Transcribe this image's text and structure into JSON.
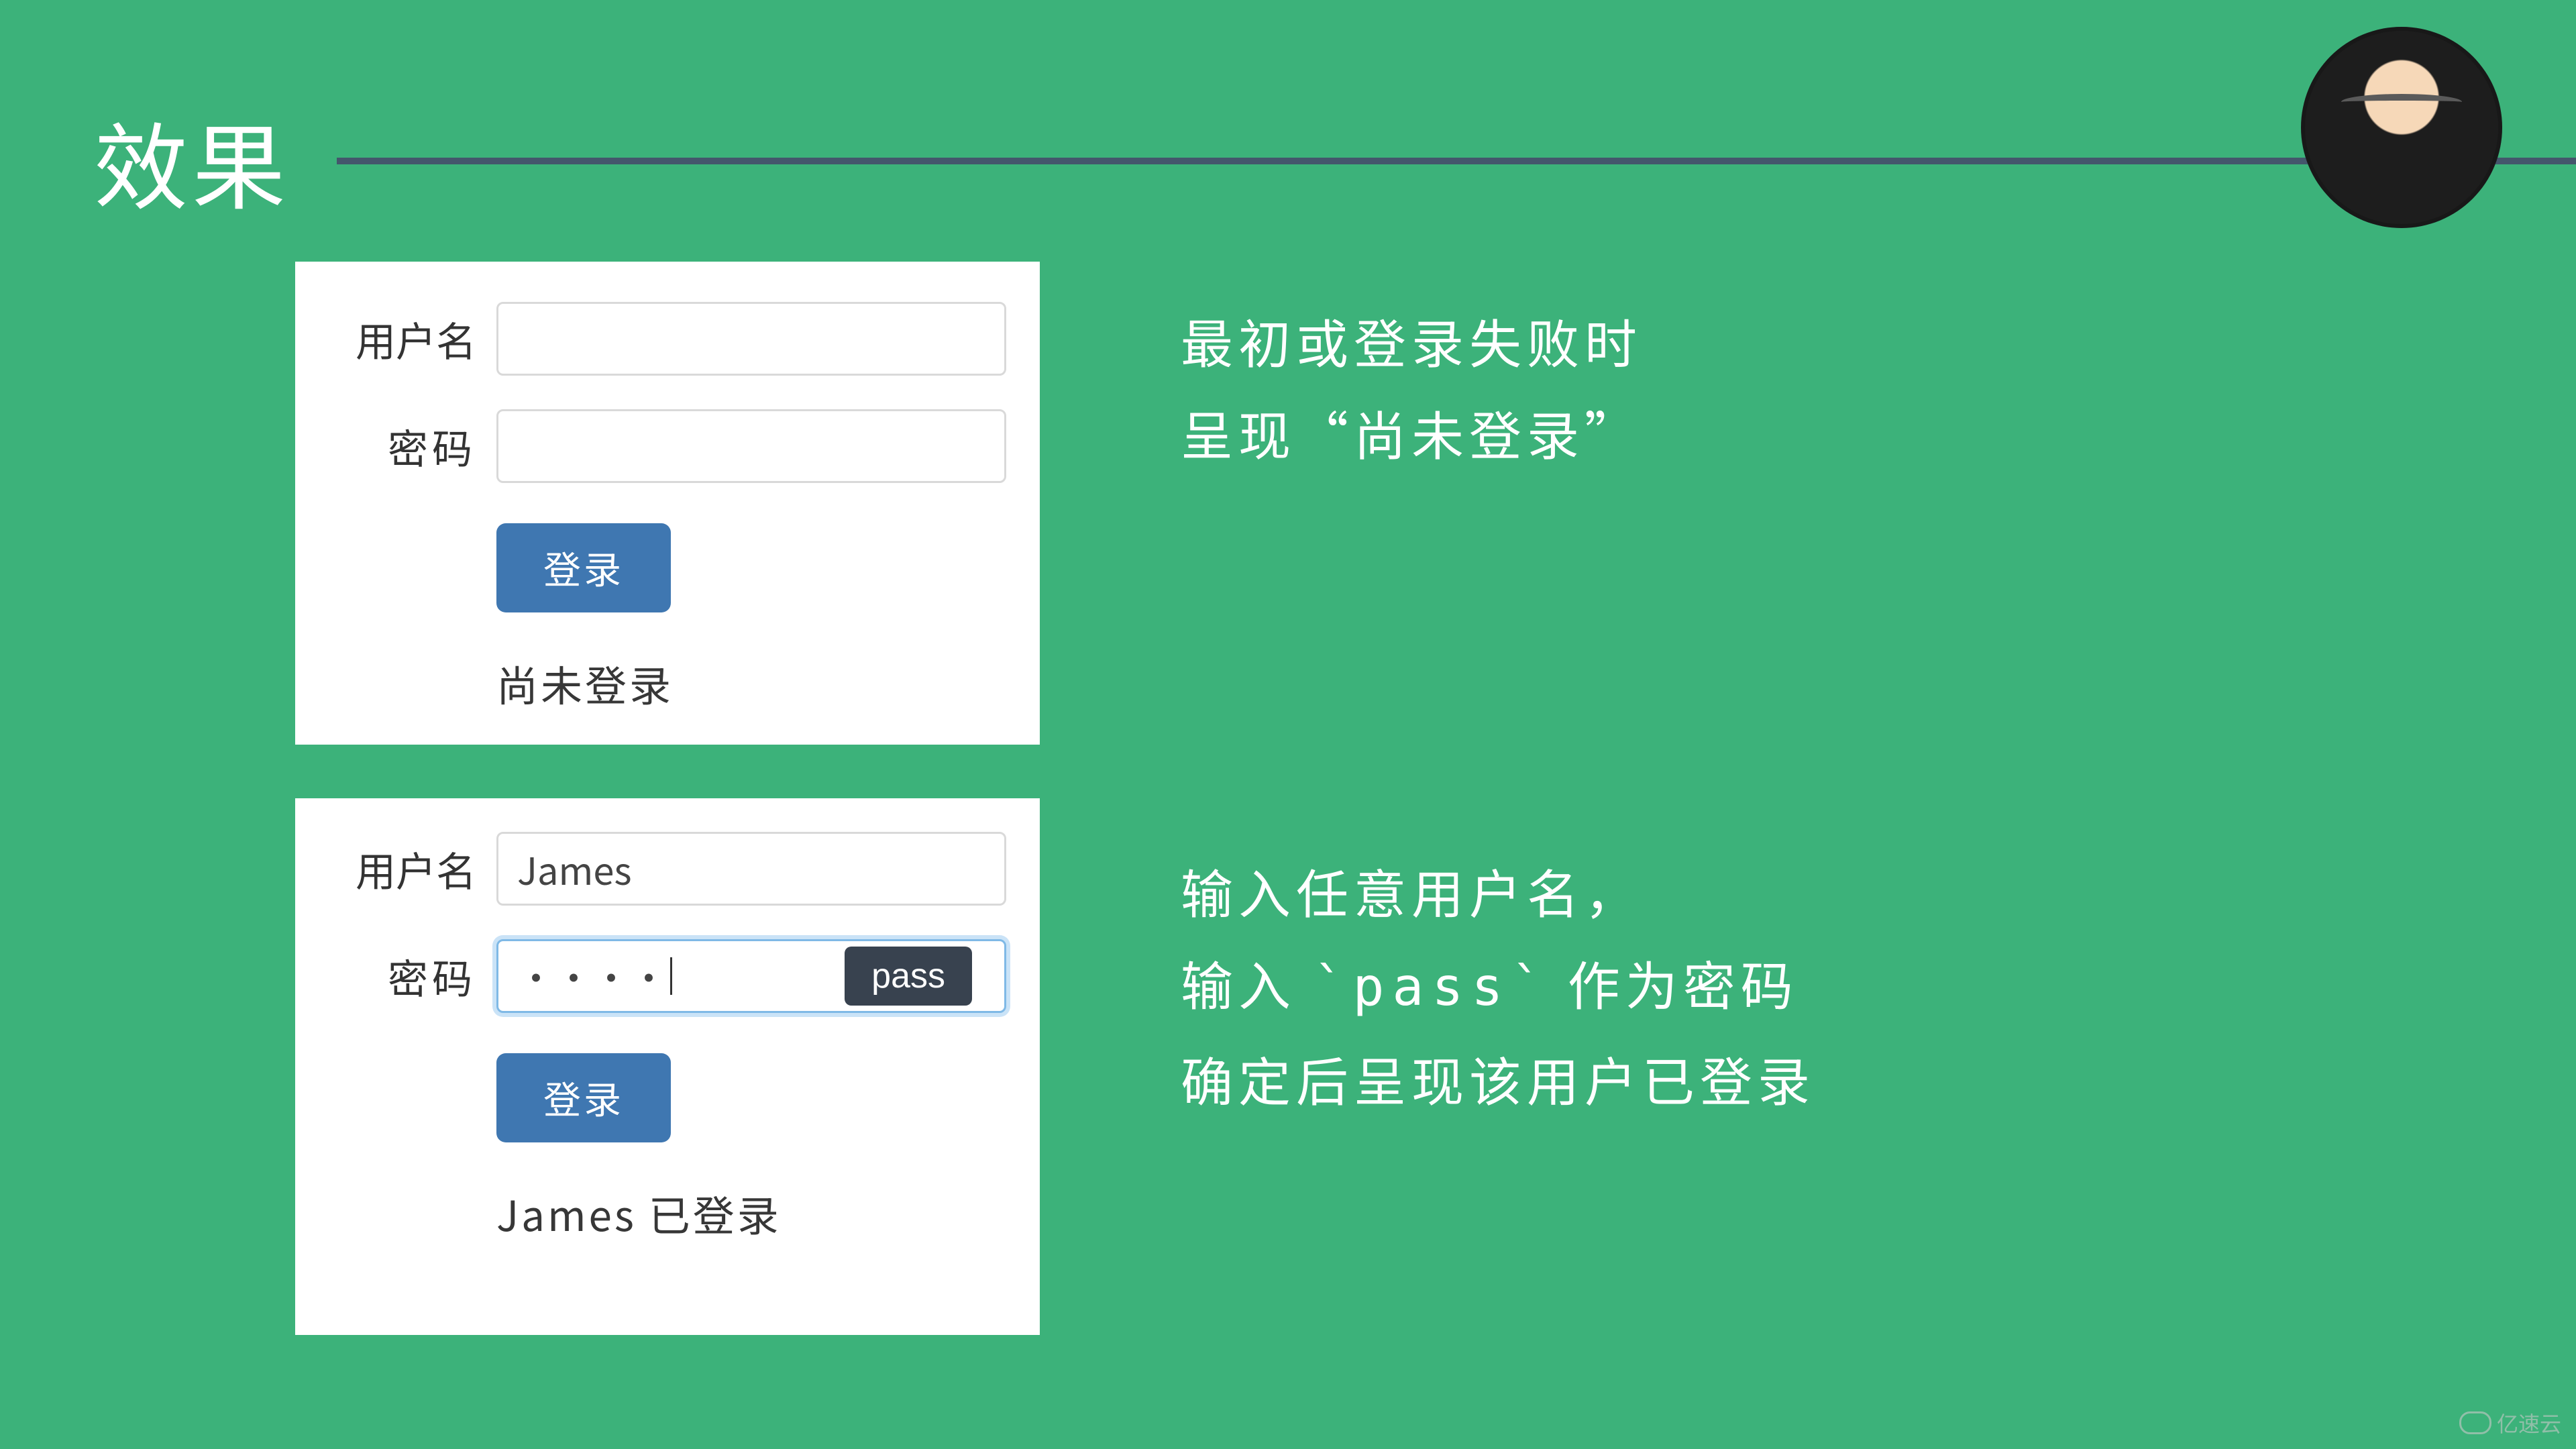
{
  "slide": {
    "title": "效果"
  },
  "forms": {
    "labels": {
      "username": "用户名",
      "password": "密码"
    },
    "login_button": "登录",
    "card1": {
      "username_value": "",
      "password_value": "",
      "status": "尚未登录"
    },
    "card2": {
      "username_value": "James",
      "password_value": "••••",
      "tooltip": "pass",
      "status": "James 已登录"
    }
  },
  "explain": {
    "block1": {
      "line1": "最初或登录失败时",
      "line2_a": "呈现",
      "line2_b": "“",
      "line2_c": "尚未登录",
      "line2_d": "”"
    },
    "block2": {
      "line1": "输入任意用户名，",
      "line2_a": "输入 ",
      "line2_code": "`pass`",
      "line2_b": " 作为密码",
      "line3": "确定后呈现该用户已登录"
    }
  },
  "watermark": "亿速云"
}
